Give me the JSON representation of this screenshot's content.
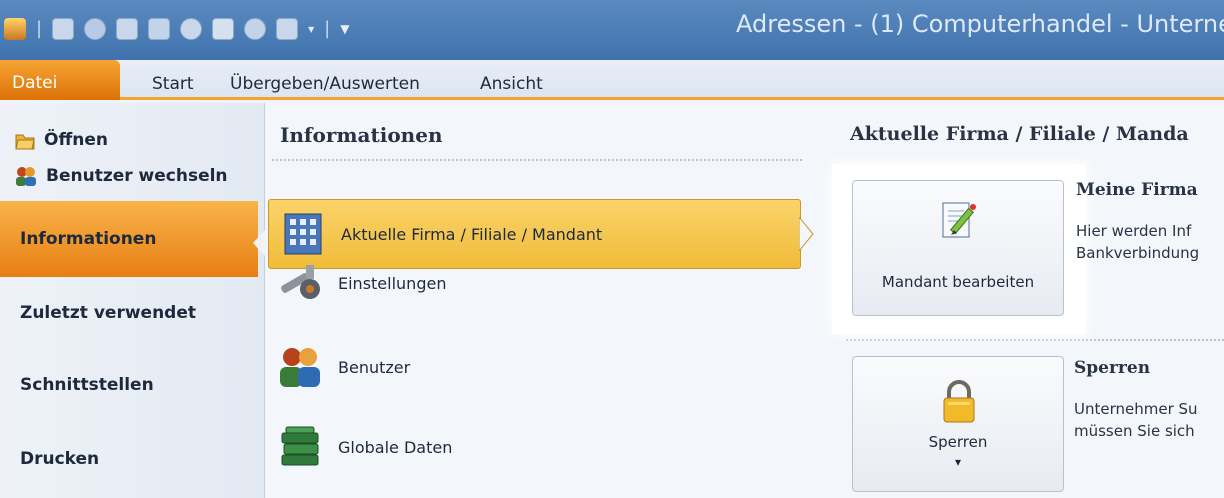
{
  "window": {
    "title": "Adressen - (1) Computerhandel - Unterne"
  },
  "quick_access": {
    "icons": [
      "app-icon",
      "undo-icon",
      "globe-icon",
      "book-icon",
      "documents-icon",
      "settings-icon",
      "edit-icon",
      "refresh-icon",
      "pin-icon"
    ],
    "customize_glyph": "▼"
  },
  "ribbon": {
    "tabs": [
      "Datei",
      "Start",
      "Übergeben/Auswerten",
      "Ansicht"
    ]
  },
  "nav": {
    "commands": [
      "Öffnen",
      "Benutzer wechseln"
    ],
    "items": [
      "Informationen",
      "Zuletzt verwendet",
      "Schnittstellen",
      "Drucken"
    ],
    "active": "Informationen"
  },
  "info_panel": {
    "heading": "Informationen",
    "items": [
      "Aktuelle Firma / Filiale / Mandant",
      "Einstellungen",
      "Benutzer",
      "Globale Daten"
    ],
    "selected": "Aktuelle Firma / Filiale / Mandant"
  },
  "detail_panel": {
    "heading": "Aktuelle Firma / Filiale / Manda",
    "section1": {
      "button_label": "Mandant bearbeiten",
      "title": "Meine Firma",
      "desc_line1": "Hier werden Inf",
      "desc_line2": "Bankverbindung"
    },
    "section2": {
      "button_label": "Sperren",
      "dropdown_glyph": "▾",
      "title": "Sperren",
      "desc_line1": "Unternehmer Su",
      "desc_line2": "müssen Sie sich"
    }
  },
  "colors": {
    "accent_orange": "#f2a332",
    "selection_yellow": "#f5c64c",
    "titlebar_blue": "#4a7db8"
  }
}
